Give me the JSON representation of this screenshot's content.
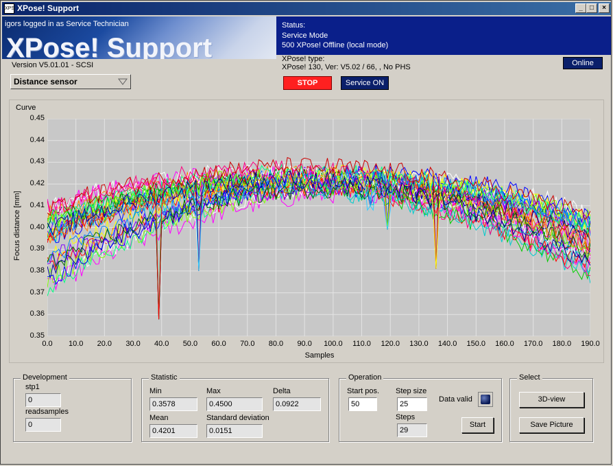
{
  "window": {
    "title": "XPose! Support",
    "icon_text": "XPS",
    "controls": {
      "minimize": "_",
      "maximize": "□",
      "close": "×"
    }
  },
  "header": {
    "login": "igors logged in as Service Technician",
    "logo": "XPose! Support",
    "version": "Version V5.01.01 - SCSI",
    "status_label": "Status:",
    "status_mode": "Service Mode",
    "status_detail": "500 XPose! Offline (local mode)",
    "type_label": "XPose! type:",
    "type_value": "XPose! 130,  Ver: V5.02 / 66, , No PHS"
  },
  "toolbar": {
    "online_label": "Online",
    "sensor_select": "Distance sensor",
    "stop_label": "STOP",
    "service_label": "Service ON"
  },
  "graph": {
    "curve_label": "Curve",
    "xlabel": "Samples",
    "ylabel": "Focus distance [mm]",
    "yticks": [
      "0.45",
      "0.44",
      "0.43",
      "0.42",
      "0.41",
      "0.40",
      "0.39",
      "0.38",
      "0.37",
      "0.36",
      "0.35"
    ],
    "xticks": [
      "0.0",
      "10.0",
      "20.0",
      "30.0",
      "40.0",
      "50.0",
      "60.0",
      "70.0",
      "80.0",
      "90.0",
      "100.0",
      "110.0",
      "120.0",
      "130.0",
      "140.0",
      "150.0",
      "160.0",
      "170.0",
      "180.0",
      "190.0"
    ]
  },
  "chart_data": {
    "type": "line",
    "title": "",
    "xlabel": "Samples",
    "ylabel": "Focus distance [mm]",
    "xlim": [
      0,
      190
    ],
    "ylim": [
      0.35,
      0.45
    ],
    "grid": true,
    "legend": "none",
    "n_series": 32,
    "colors": [
      "#ff0000",
      "#00cc00",
      "#0000ff",
      "#ff00ff",
      "#00cccc",
      "#ffff00",
      "#ffffff",
      "#ff8000",
      "#8000ff",
      "#00ff80",
      "#ff0080",
      "#0080ff",
      "#80ff00",
      "#cc0000",
      "#006600",
      "#000099"
    ],
    "series": [
      {
        "name": "",
        "values_sampled": {
          "x": [
            0,
            20,
            40,
            60,
            80,
            100,
            120,
            140,
            160,
            180,
            190
          ],
          "y": [
            0.405,
            0.415,
            0.425,
            0.432,
            0.438,
            0.436,
            0.432,
            0.425,
            0.415,
            0.4,
            0.395
          ]
        }
      },
      {
        "name": "",
        "values_sampled": {
          "x": [
            0,
            20,
            40,
            60,
            80,
            100,
            120,
            140,
            160,
            180,
            190
          ],
          "y": [
            0.375,
            0.392,
            0.415,
            0.43,
            0.44,
            0.438,
            0.43,
            0.42,
            0.405,
            0.385,
            0.38
          ]
        }
      }
    ],
    "spikes": [
      {
        "x": 39,
        "y": 0.3578,
        "color": "#ff0000"
      },
      {
        "x": 53,
        "y": 0.38,
        "color": "#33ccff"
      },
      {
        "x": 113,
        "y": 0.41,
        "color": "#33ccff"
      },
      {
        "x": 119,
        "y": 0.399,
        "color": "#33ccff"
      },
      {
        "x": 136,
        "y": 0.381,
        "color": "#ffff00"
      }
    ]
  },
  "development": {
    "title": "Development",
    "stp1_label": "stp1",
    "stp1_value": "0",
    "readsamples_label": "readsamples",
    "readsamples_value": "0"
  },
  "statistic": {
    "title": "Statistic",
    "min_label": "Min",
    "min_value": "0.3578",
    "max_label": "Max",
    "max_value": "0.4500",
    "delta_label": "Delta",
    "delta_value": "0.0922",
    "mean_label": "Mean",
    "mean_value": "0.4201",
    "std_label": "Standard deviation",
    "std_value": "0.0151"
  },
  "operation": {
    "title": "Operation",
    "start_label": "Start pos.",
    "start_value": "50",
    "step_label": "Step size",
    "step_value": "25",
    "steps_label": "Steps",
    "steps_value": "29",
    "valid_label": "Data valid",
    "start_button": "Start"
  },
  "select": {
    "title": "Select",
    "view3d_button": "3D-view",
    "save_button": "Save Picture"
  }
}
